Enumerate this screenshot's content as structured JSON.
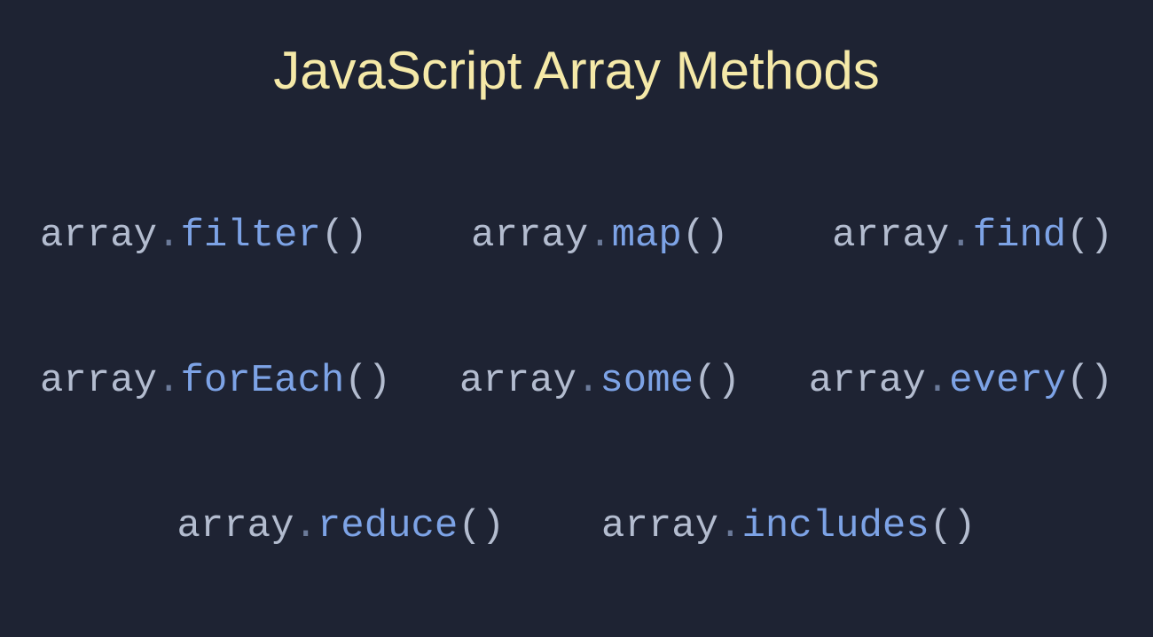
{
  "title": "JavaScript Array Methods",
  "methods": {
    "row1": [
      {
        "obj": "array",
        "dot": ".",
        "fn": "filter",
        "paren": "()"
      },
      {
        "obj": "array",
        "dot": ".",
        "fn": "map",
        "paren": "()"
      },
      {
        "obj": "array",
        "dot": ".",
        "fn": "find",
        "paren": "()"
      }
    ],
    "row2": [
      {
        "obj": "array",
        "dot": ".",
        "fn": "forEach",
        "paren": "()"
      },
      {
        "obj": "array",
        "dot": ".",
        "fn": "some",
        "paren": "()"
      },
      {
        "obj": "array",
        "dot": ".",
        "fn": "every",
        "paren": "()"
      }
    ],
    "row3": [
      {
        "obj": "array",
        "dot": ".",
        "fn": "reduce",
        "paren": "()"
      },
      {
        "obj": "array",
        "dot": ".",
        "fn": "includes",
        "paren": "()"
      }
    ]
  }
}
